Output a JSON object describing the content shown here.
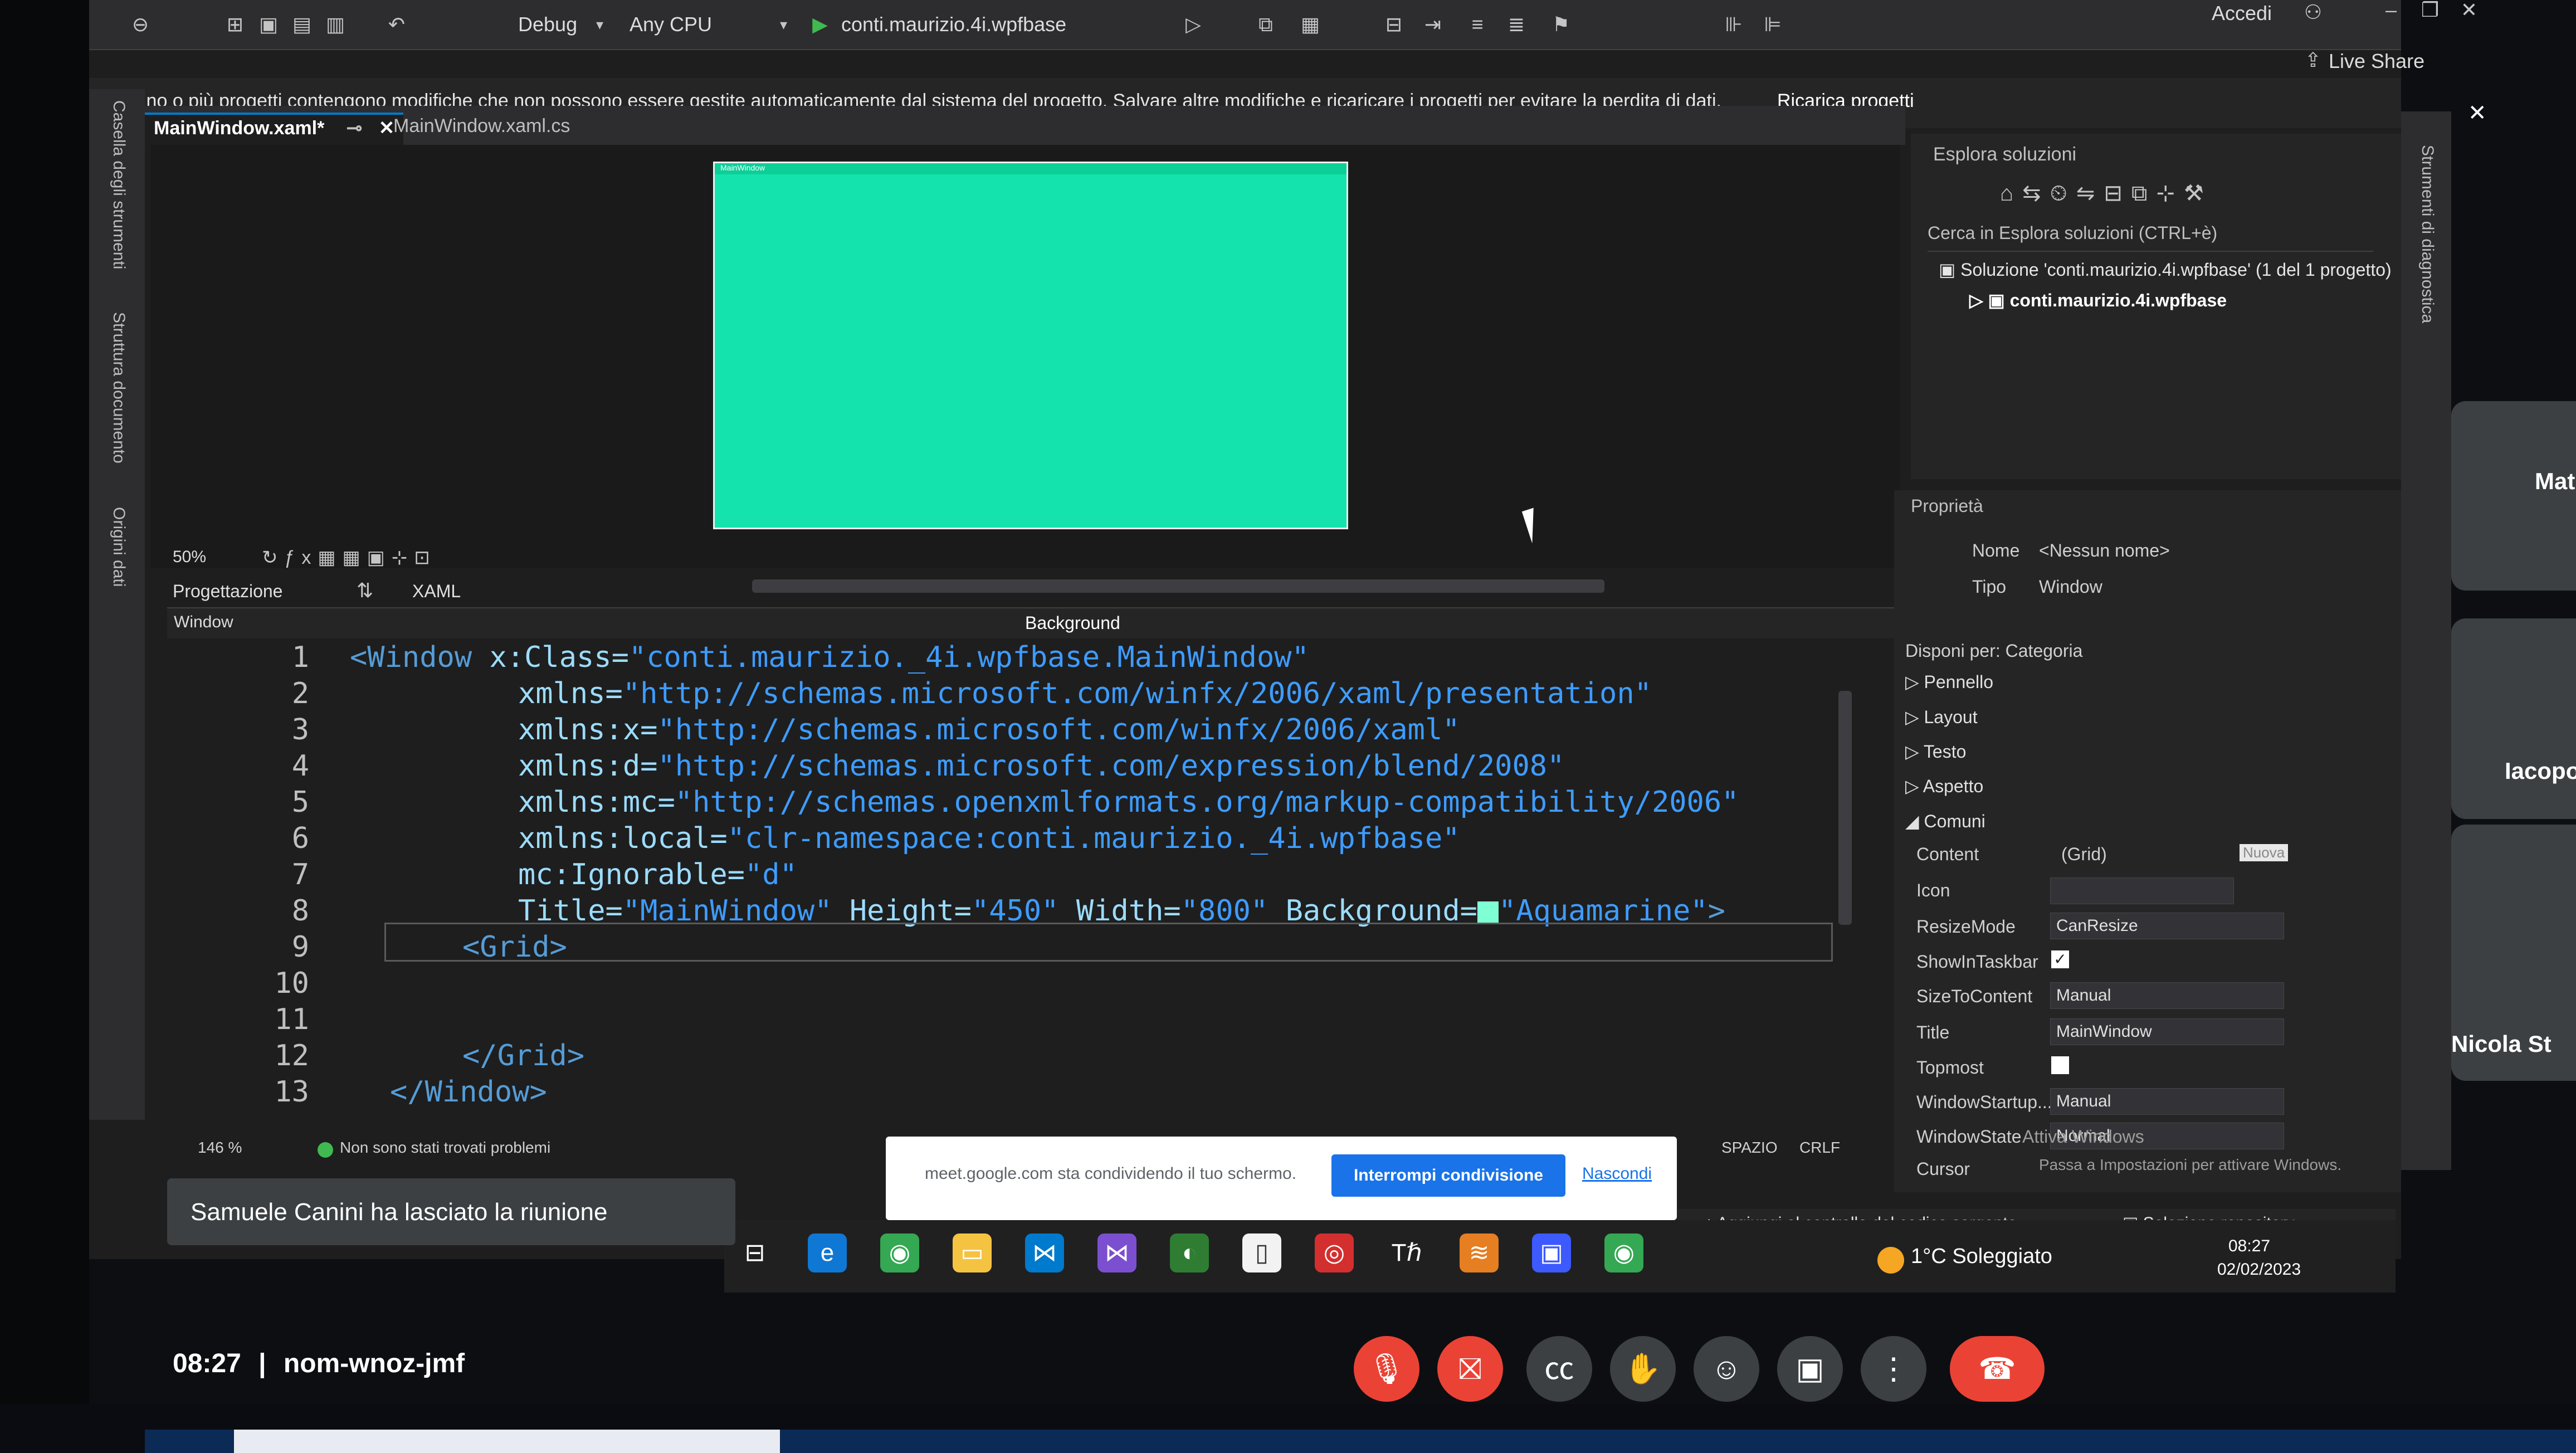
{
  "toolbar": {
    "config": "Debug",
    "platform": "Any CPU",
    "startup": "conti.maurizio.4i.wpfbase",
    "accedi": "Accedi",
    "live_share": "Live Share"
  },
  "warning": {
    "text": "Uno o più progetti contengono modifiche che non possono essere gestite automaticamente dal sistema del progetto. Salvare altre modifiche e ricaricare i progetti per evitare la perdita di dati.",
    "action": "Ricarica progetti"
  },
  "left_strip": [
    "Casella degli strumenti",
    "Struttura documento",
    "Origini dati"
  ],
  "tabs": [
    {
      "label": "MainWindow.xaml*",
      "active": true
    },
    {
      "label": "MainWindow.xaml.cs",
      "active": false
    }
  ],
  "designer": {
    "preview_title": "MainWindow",
    "preview_color": "#15e3ae",
    "zoom": "50%",
    "view_design": "Progettazione",
    "view_xaml": "XAML"
  },
  "navbar": {
    "left": "Window",
    "right": "Background"
  },
  "editor": {
    "line_numbers": [
      "1",
      "2",
      "3",
      "4",
      "5",
      "6",
      "7",
      "8",
      "9",
      "10",
      "11",
      "12",
      "13"
    ],
    "line1_tag": "<Window",
    "line1_attr": "x:Class=",
    "line1_val": "\"conti.maurizio._4i.wpfbase.MainWindow\"",
    "line2_attr": "xmlns=",
    "line2_val": "\"http://schemas.microsoft.com/winfx/2006/xaml/presentation\"",
    "line3_attr": "xmlns:x=",
    "line3_val": "\"http://schemas.microsoft.com/winfx/2006/xaml\"",
    "line4_attr": "xmlns:d=",
    "line4_val": "\"http://schemas.microsoft.com/expression/blend/2008\"",
    "line5_attr": "xmlns:mc=",
    "line5_val": "\"http://schemas.openxmlformats.org/markup-compatibility/2006\"",
    "line6_attr": "xmlns:local=",
    "line6_val": "\"clr-namespace:conti.maurizio._4i.wpfbase\"",
    "line7_attr": "mc:Ignorable=",
    "line7_val": "\"d\"",
    "line8_a1": "Title=",
    "line8_v1": "\"MainWindow\"",
    "line8_a2": "Height=",
    "line8_v2": "\"450\"",
    "line8_a3": "Width=",
    "line8_v3": "\"800\"",
    "line8_a4": "Background=",
    "line8_v4": "\"Aquamarine\"",
    "line8_end": ">",
    "line9": "<Grid>",
    "line11": "</Grid>",
    "line12": "</Window>"
  },
  "status": {
    "zoom": "146 %",
    "problems": "Non sono stati trovati problemi",
    "spaces": "SPAZIO",
    "eol": "CRLF"
  },
  "solution_explorer": {
    "title": "Esplora soluzioni",
    "search": "Cerca in Esplora soluzioni (CTRL+è)",
    "root": "Soluzione 'conti.maurizio.4i.wpfbase' (1 del 1 progetto)",
    "project": "conti.maurizio.4i.wpfbase"
  },
  "properties": {
    "title": "Proprietà",
    "name_label": "Nome",
    "name_value": "<Nessun nome>",
    "type_label": "Tipo",
    "type_value": "Window",
    "arrange": "Disponi per: Categoria",
    "categories": [
      "Pennello",
      "Layout",
      "Testo",
      "Aspetto",
      "Comuni"
    ],
    "content_label": "Content",
    "content_value": "(Grid)",
    "content_button": "Nuova",
    "icon_label": "Icon",
    "resize_label": "ResizeMode",
    "resize_value": "CanResize",
    "taskbar_label": "ShowInTaskbar",
    "size_label": "SizeToContent",
    "size_value": "Manual",
    "title_label": "Title",
    "title_value": "MainWindow",
    "topmost_label": "Topmost",
    "startup_label": "WindowStartup...",
    "startup_value": "Manual",
    "state_label": "WindowState",
    "state_value": "Normal",
    "cursor_label": "Cursor",
    "activate_title": "Attiva Windows",
    "activate_text": "Passa a Impostazioni per attivare Windows."
  },
  "right_strip": "Strumenti di diagnostica",
  "source_bar": {
    "add": "Aggiungi al controllo del codice sorgente",
    "repo": "Seleziona repository"
  },
  "share": {
    "text": "meet.google.com sta condividendo il tuo schermo.",
    "stop": "Interrompi condivisione",
    "hide": "Nascondi"
  },
  "notice": "Samuele Canini ha lasciato la riunione",
  "weather": "1°C Soleggiato",
  "tray": {
    "time": "08:27",
    "date": "02/02/2023"
  },
  "participants": [
    "Mat",
    "Iacopo",
    "Nicola St"
  ],
  "meet": {
    "time": "08:27",
    "code": "nom-wnoz-jmf"
  },
  "colors": {
    "accent": "#007acc",
    "string": "#3e9cff",
    "preview": "#15e3ae",
    "leave": "#ea4335"
  }
}
